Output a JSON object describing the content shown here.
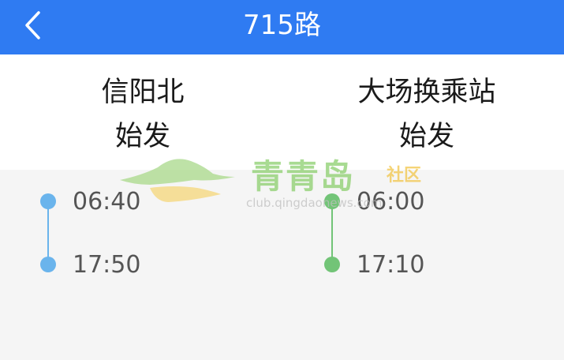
{
  "header": {
    "title": "715路",
    "background": "#2f7bf2"
  },
  "columns": {
    "left": {
      "station": "信阳北",
      "depart": "始发",
      "color": "#6ab4ec",
      "times": [
        "06:40",
        "17:50"
      ]
    },
    "right": {
      "station": "大场换乘站",
      "depart": "始发",
      "color": "#72c477",
      "times": [
        "06:00",
        "17:10"
      ]
    }
  },
  "watermark": {
    "name": "青青岛",
    "tag": "社区",
    "url": "club.qingdaonews.com"
  }
}
